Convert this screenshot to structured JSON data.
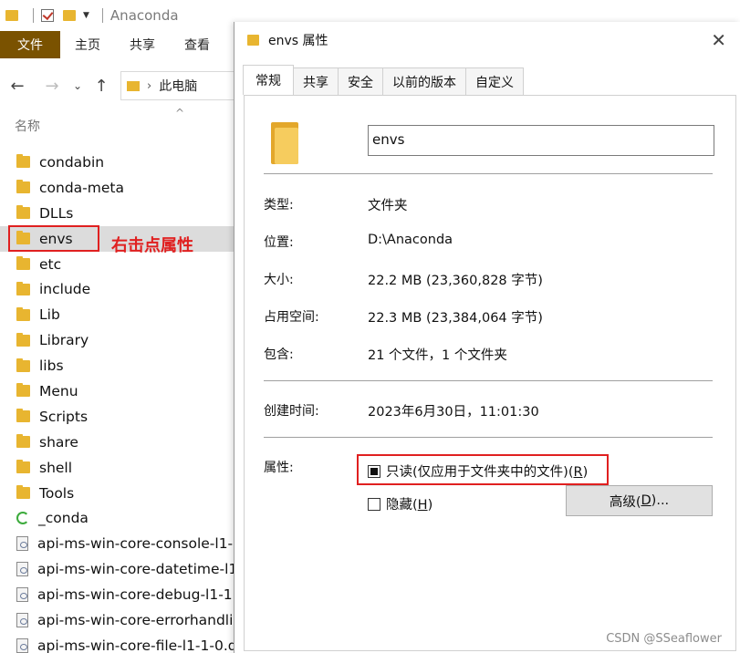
{
  "explorer": {
    "title": "Anaconda",
    "ribbon_tabs": [
      "文件",
      "主页",
      "共享",
      "查看"
    ],
    "breadcrumb": "此电脑",
    "column_header": "名称",
    "files": [
      {
        "name": "condabin",
        "type": "folder"
      },
      {
        "name": "conda-meta",
        "type": "folder"
      },
      {
        "name": "DLLs",
        "type": "folder"
      },
      {
        "name": "envs",
        "type": "folder",
        "selected": true
      },
      {
        "name": "etc",
        "type": "folder"
      },
      {
        "name": "include",
        "type": "folder"
      },
      {
        "name": "Lib",
        "type": "folder"
      },
      {
        "name": "Library",
        "type": "folder"
      },
      {
        "name": "libs",
        "type": "folder"
      },
      {
        "name": "Menu",
        "type": "folder"
      },
      {
        "name": "Scripts",
        "type": "folder"
      },
      {
        "name": "share",
        "type": "folder"
      },
      {
        "name": "shell",
        "type": "folder"
      },
      {
        "name": "Tools",
        "type": "folder"
      },
      {
        "name": "_conda",
        "type": "conda"
      },
      {
        "name": "api-ms-win-core-console-l1-",
        "type": "dll"
      },
      {
        "name": "api-ms-win-core-datetime-l1",
        "type": "dll"
      },
      {
        "name": "api-ms-win-core-debug-l1-1",
        "type": "dll"
      },
      {
        "name": "api-ms-win-core-errorhandli",
        "type": "dll"
      },
      {
        "name": "api-ms-win-core-file-l1-1-0.d",
        "type": "dll"
      }
    ],
    "annotation": "右击点属性"
  },
  "dialog": {
    "title": "envs 属性",
    "tabs": [
      "常规",
      "共享",
      "安全",
      "以前的版本",
      "自定义"
    ],
    "active_tab": "常规",
    "folder_name": "envs",
    "properties": {
      "type_label": "类型:",
      "type_value": "文件夹",
      "location_label": "位置:",
      "location_value": "D:\\Anaconda",
      "size_label": "大小:",
      "size_value": "22.2 MB (23,360,828 字节)",
      "disk_label": "占用空间:",
      "disk_value": "22.3 MB (23,384,064 字节)",
      "contains_label": "包含:",
      "contains_value": "21 个文件，1 个文件夹",
      "created_label": "创建时间:",
      "created_value": "2023年6月30日，11:01:30",
      "attributes_label": "属性:"
    },
    "readonly_label": "只读(仅应用于文件夹中的文件)(",
    "readonly_key": "R",
    "hidden_label": "隐藏(",
    "hidden_key": "H",
    "advanced_label": "高级(",
    "advanced_key": "D",
    "advanced_suffix": ")..."
  },
  "watermark": "CSDN @SSeaflower"
}
